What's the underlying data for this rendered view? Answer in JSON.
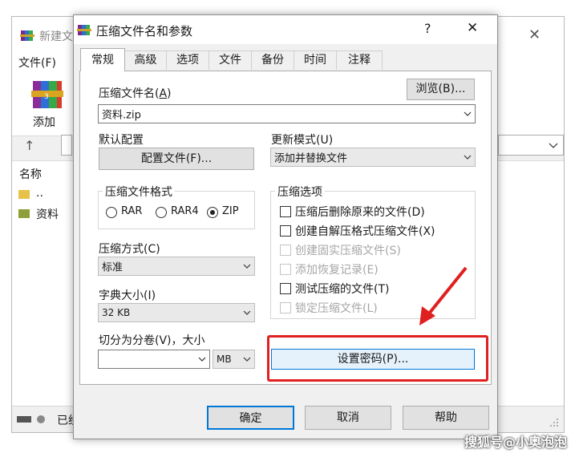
{
  "background_window": {
    "title": "新建文",
    "menu_file": "文件(F)",
    "add_label": "添加",
    "column_name": "名称",
    "rows": [
      {
        "name": ".."
      },
      {
        "name": "资料"
      }
    ],
    "status_text": "已经"
  },
  "dialog": {
    "title": "压缩文件名和参数",
    "help_glyph": "?",
    "close_glyph": "✕",
    "tabs": [
      "常规",
      "高级",
      "选项",
      "文件",
      "备份",
      "时间",
      "注释"
    ],
    "active_tab": "常规",
    "archive_name_label": "压缩文件名(A)",
    "archive_name_label_prefix": "压缩文件名(",
    "archive_name_label_key": "A",
    "archive_name_value": "资料.zip",
    "browse_button": "浏览(B)...",
    "default_profile_label": "默认配置",
    "profile_button": "配置文件(F)...",
    "update_mode_label": "更新模式(U)",
    "update_mode_value": "添加并替换文件",
    "format_group_title": "压缩文件格式",
    "formats": [
      {
        "label": "RAR",
        "selected": false
      },
      {
        "label": "RAR4",
        "selected": false
      },
      {
        "label": "ZIP",
        "selected": true
      }
    ],
    "method_label": "压缩方式(C)",
    "method_value": "标准",
    "dict_label": "字典大小(I)",
    "dict_value": "32 KB",
    "split_label": "切分为分卷(V)，大小",
    "split_value": "",
    "split_unit": "MB",
    "options_group_title": "压缩选项",
    "options": [
      {
        "label": "压缩后删除原来的文件(D)",
        "checked": false,
        "disabled": false
      },
      {
        "label": "创建自解压格式压缩文件(X)",
        "checked": false,
        "disabled": false
      },
      {
        "label": "创建固实压缩文件(S)",
        "checked": false,
        "disabled": true
      },
      {
        "label": "添加恢复记录(E)",
        "checked": false,
        "disabled": true
      },
      {
        "label": "测试压缩的文件(T)",
        "checked": false,
        "disabled": false
      },
      {
        "label": "锁定压缩文件(L)",
        "checked": false,
        "disabled": true
      }
    ],
    "password_button": "设置密码(P)...",
    "ok_button": "确定",
    "cancel_button": "取消",
    "help_button": "帮助"
  },
  "watermark": "搜狐号@小奥泡泡",
  "colors": {
    "highlight_border": "#e02020",
    "arrow": "#e02020",
    "focus_button_border": "#0078d7",
    "dialog_bg": "#f0f0f0"
  }
}
